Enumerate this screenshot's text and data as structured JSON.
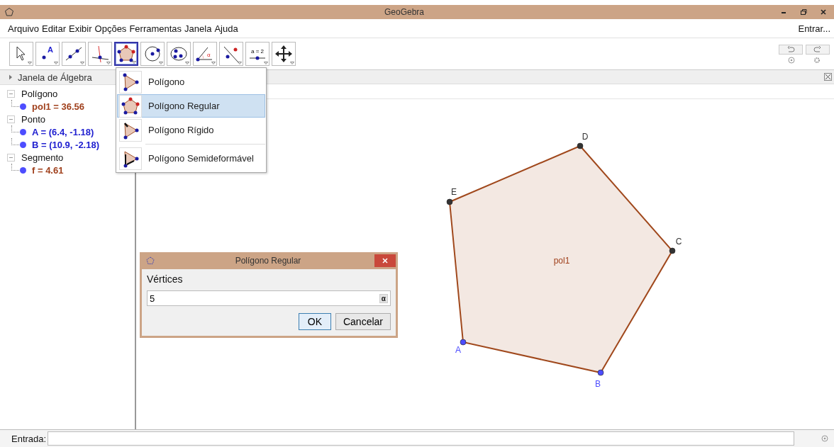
{
  "window": {
    "title": "GeoGebra"
  },
  "menu": {
    "items": [
      "Arquivo",
      "Editar",
      "Exibir",
      "Opções",
      "Ferramentas",
      "Janela",
      "Ajuda"
    ],
    "login": "Entrar..."
  },
  "toolbar": {
    "tools": [
      {
        "kind": "move",
        "selected": false
      },
      {
        "kind": "point",
        "selected": false,
        "icon_text": "A"
      },
      {
        "kind": "line",
        "selected": false
      },
      {
        "kind": "perpendicular",
        "selected": false
      },
      {
        "kind": "polygon",
        "selected": true
      },
      {
        "kind": "circle",
        "selected": false
      },
      {
        "kind": "conic",
        "selected": false
      },
      {
        "kind": "angle",
        "selected": false,
        "icon_text": "α"
      },
      {
        "kind": "reflect",
        "selected": false
      },
      {
        "kind": "slider",
        "selected": false,
        "icon_text": "a = 2"
      },
      {
        "kind": "pan",
        "selected": false
      }
    ]
  },
  "algebra": {
    "title": "Janela de Álgebra",
    "groups": [
      {
        "label": "Polígono",
        "expanded": true,
        "children": [
          {
            "label": "pol1 = 36.56",
            "color": "#a0401c"
          }
        ]
      },
      {
        "label": "Ponto",
        "expanded": true,
        "children": [
          {
            "label": "A = (6.4, -1.18)",
            "color": "#2020d0"
          },
          {
            "label": "B = (10.9, -2.18)",
            "color": "#2020d0"
          }
        ]
      },
      {
        "label": "Segmento",
        "expanded": true,
        "children": [
          {
            "label": "f = 4.61",
            "color": "#a0401c"
          }
        ]
      }
    ]
  },
  "tool_menu": {
    "items": [
      {
        "label": "Polígono",
        "kind": "polygon",
        "selected": false
      },
      {
        "label": "Polígono Regular",
        "kind": "regular",
        "selected": true
      },
      {
        "label": "Polígono Rígido",
        "kind": "rigid",
        "selected": false
      },
      {
        "label": "Polígono Semideformável",
        "kind": "vector",
        "selected": false
      }
    ]
  },
  "graphics": {
    "polygon_label": "pol1",
    "points": [
      {
        "label": "D",
        "color": "#333333"
      },
      {
        "label": "C",
        "color": "#333333"
      },
      {
        "label": "B",
        "color": "#4d4dff"
      },
      {
        "label": "A",
        "color": "#4d4dff"
      },
      {
        "label": "E",
        "color": "#333333"
      }
    ]
  },
  "dialog": {
    "title": "Polígono Regular",
    "field_label": "Vértices",
    "value": "5",
    "symbol_button": "α",
    "buttons": [
      {
        "label": "OK",
        "default": true
      },
      {
        "label": "Cancelar",
        "default": false
      }
    ]
  },
  "input_bar": {
    "label": "Entrada:"
  }
}
